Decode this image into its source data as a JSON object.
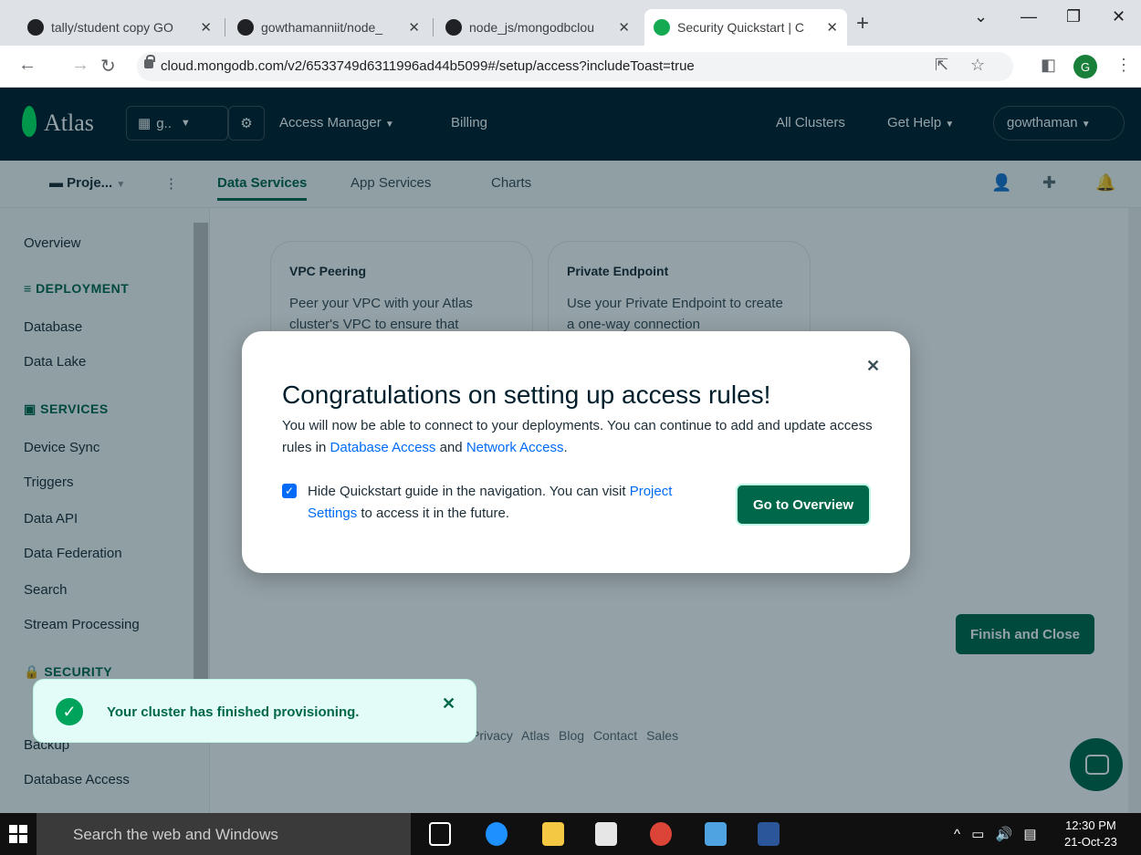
{
  "browser": {
    "tabs": [
      {
        "title": "tally/student copy GO"
      },
      {
        "title": "gowthamanniit/node_"
      },
      {
        "title": "node_js/mongodbclou"
      },
      {
        "title": "Security Quickstart | C"
      }
    ],
    "new_tab": "+",
    "url": "cloud.mongodb.com/v2/6533749d6311996ad44b5099#/setup/access?includeToast=true",
    "profile_initial": "G"
  },
  "atlas_header": {
    "logo": "Atlas",
    "org": "g..",
    "nav": [
      "Access Manager",
      "Billing"
    ],
    "all_clusters": "All Clusters",
    "get_help": "Get Help",
    "user": "gowthaman"
  },
  "project_bar": {
    "project": "Proje...",
    "tabs": [
      "Data Services",
      "App Services",
      "Charts"
    ]
  },
  "sidebar": {
    "overview": "Overview",
    "deployment": {
      "heading": "DEPLOYMENT",
      "items": [
        "Database",
        "Data Lake"
      ]
    },
    "services": {
      "heading": "SERVICES",
      "items": [
        "Device Sync",
        "Triggers",
        "Data API",
        "Data Federation",
        "Search",
        "Stream Processing"
      ]
    },
    "security": {
      "heading": "SECURITY",
      "items": [
        "Backup",
        "Database Access"
      ]
    }
  },
  "cards": [
    {
      "title": "VPC Peering",
      "text": "Peer your VPC with your Atlas cluster's VPC to ensure that"
    },
    {
      "title": "Private Endpoint",
      "text": "Use your Private Endpoint to create a one-way connection"
    }
  ],
  "finish_button": "Finish and Close",
  "footer_links": "Privacy Atlas Blog Contact Sales",
  "toast": {
    "message": "Your cluster has finished provisioning."
  },
  "modal": {
    "title": "Congratulations on setting up access rules!",
    "body_start": "You will now be able to connect to your deployments. You can continue to add and update access rules in ",
    "link_database_access": "Database Access",
    "body_and": " and ",
    "link_network_access": "Network Access",
    "body_end": ".",
    "checkbox_text_start": "Hide Quickstart guide in the navigation. You can visit ",
    "link_project_settings": "Project Settings",
    "checkbox_text_end": " to access it in the future.",
    "checkbox_checked": true,
    "button": "Go to Overview"
  },
  "taskbar": {
    "search_placeholder": "Search the web and Windows",
    "time": "12:30 PM",
    "date": "21-Oct-23"
  },
  "colors": {
    "accent": "#00684a",
    "link": "#016bf8",
    "header_bg": "#001e2b"
  }
}
